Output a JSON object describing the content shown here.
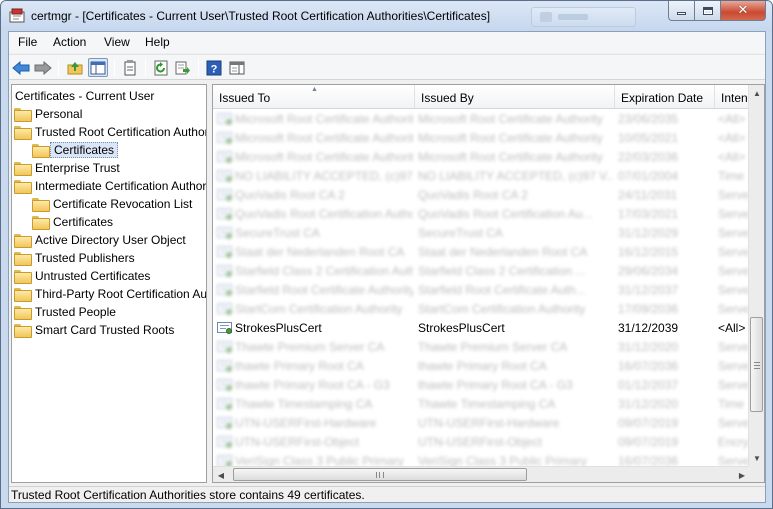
{
  "window": {
    "title": "certmgr - [Certificates - Current User\\Trusted Root Certification Authorities\\Certificates]",
    "close_glyph": "✕"
  },
  "menu": [
    "File",
    "Action",
    "View",
    "Help"
  ],
  "toolbar": {
    "icons": [
      "back-arrow-icon",
      "forward-arrow-icon",
      "up-folder-icon",
      "show-hide-tree-icon",
      "properties-icon",
      "refresh-icon",
      "export-list-icon",
      "help-icon",
      "action-pane-icon"
    ]
  },
  "tree": {
    "root": "Certificates - Current User",
    "items": [
      {
        "label": "Personal",
        "depth": 1
      },
      {
        "label": "Trusted Root Certification Authorities",
        "depth": 1
      },
      {
        "label": "Certificates",
        "depth": 2,
        "selected": true
      },
      {
        "label": "Enterprise Trust",
        "depth": 1
      },
      {
        "label": "Intermediate Certification Authorities",
        "depth": 1
      },
      {
        "label": "Certificate Revocation List",
        "depth": 2
      },
      {
        "label": "Certificates",
        "depth": 2
      },
      {
        "label": "Active Directory User Object",
        "depth": 1
      },
      {
        "label": "Trusted Publishers",
        "depth": 1
      },
      {
        "label": "Untrusted Certificates",
        "depth": 1
      },
      {
        "label": "Third-Party Root Certification Authorities",
        "depth": 1
      },
      {
        "label": "Trusted People",
        "depth": 1
      },
      {
        "label": "Smart Card Trusted Roots",
        "depth": 1
      }
    ]
  },
  "list": {
    "columns": [
      "Issued To",
      "Issued By",
      "Expiration Date",
      "Intended Purposes"
    ],
    "rows": [
      {
        "issued_to": "Microsoft Root Certificate Authority",
        "issued_by": "Microsoft Root Certificate Authority",
        "expiration": "23/06/2035",
        "purpose": "<All>",
        "blurred": true
      },
      {
        "issued_to": "Microsoft Root Certificate Authority",
        "issued_by": "Microsoft Root Certificate Authority",
        "expiration": "10/05/2021",
        "purpose": "<All>",
        "blurred": true
      },
      {
        "issued_to": "Microsoft Root Certificate Authority",
        "issued_by": "Microsoft Root Certificate Authority",
        "expiration": "22/03/2036",
        "purpose": "<All>",
        "blurred": true
      },
      {
        "issued_to": "NO LIABILITY ACCEPTED, (c)97 VeriSign",
        "issued_by": "NO LIABILITY ACCEPTED, (c)97 V...",
        "expiration": "07/01/2004",
        "purpose": "Time",
        "blurred": true
      },
      {
        "issued_to": "QuoVadis Root CA 2",
        "issued_by": "QuoVadis Root CA 2",
        "expiration": "24/11/2031",
        "purpose": "Serve",
        "blurred": true
      },
      {
        "issued_to": "QuoVadis Root Certification Authority",
        "issued_by": "QuoVadis Root Certification Au...",
        "expiration": "17/03/2021",
        "purpose": "Serve",
        "blurred": true
      },
      {
        "issued_to": "SecureTrust CA",
        "issued_by": "SecureTrust CA",
        "expiration": "31/12/2029",
        "purpose": "Serve",
        "blurred": true
      },
      {
        "issued_to": "Staat der Nederlanden Root CA",
        "issued_by": "Staat der Nederlanden Root CA",
        "expiration": "16/12/2015",
        "purpose": "Serve",
        "blurred": true
      },
      {
        "issued_to": "Starfield Class 2 Certification Authority",
        "issued_by": "Starfield Class 2 Certification ...",
        "expiration": "29/06/2034",
        "purpose": "Serve",
        "blurred": true
      },
      {
        "issued_to": "Starfield Root Certificate Authority",
        "issued_by": "Starfield Root Certificate Auth...",
        "expiration": "31/12/2037",
        "purpose": "Serve",
        "blurred": true
      },
      {
        "issued_to": "StartCom Certification Authority",
        "issued_by": "StartCom Certification Authority",
        "expiration": "17/09/2036",
        "purpose": "Serve",
        "blurred": true
      },
      {
        "issued_to": "StrokesPlusCert",
        "issued_by": "StrokesPlusCert",
        "expiration": "31/12/2039",
        "purpose": "<All>",
        "blurred": false
      },
      {
        "issued_to": "Thawte Premium Server CA",
        "issued_by": "Thawte Premium Server CA",
        "expiration": "31/12/2020",
        "purpose": "Serve",
        "blurred": true
      },
      {
        "issued_to": "thawte Primary Root CA",
        "issued_by": "thawte Primary Root CA",
        "expiration": "16/07/2036",
        "purpose": "Serve",
        "blurred": true
      },
      {
        "issued_to": "thawte Primary Root CA - G3",
        "issued_by": "thawte Primary Root CA - G3",
        "expiration": "01/12/2037",
        "purpose": "Serve",
        "blurred": true
      },
      {
        "issued_to": "Thawte Timestamping CA",
        "issued_by": "Thawte Timestamping CA",
        "expiration": "31/12/2020",
        "purpose": "Time",
        "blurred": true
      },
      {
        "issued_to": "UTN-USERFirst-Hardware",
        "issued_by": "UTN-USERFirst-Hardware",
        "expiration": "09/07/2019",
        "purpose": "Serve",
        "blurred": true
      },
      {
        "issued_to": "UTN-USERFirst-Object",
        "issued_by": "UTN-USERFirst-Object",
        "expiration": "09/07/2019",
        "purpose": "Encry",
        "blurred": true
      },
      {
        "issued_to": "VeriSign Class 3 Public Primary",
        "issued_by": "VeriSign Class 3 Public Primary",
        "expiration": "16/07/2036",
        "purpose": "Serve",
        "blurred": true
      }
    ]
  },
  "scroll": {
    "vertical_position": 0.58,
    "horizontal_position": 0.0
  },
  "status": {
    "text": "Trusted Root Certification Authorities store contains 49 certificates."
  },
  "colors": {
    "selection": "#dae6f7",
    "title_bar": "#c6d7ee",
    "close_button": "#c94a31"
  }
}
